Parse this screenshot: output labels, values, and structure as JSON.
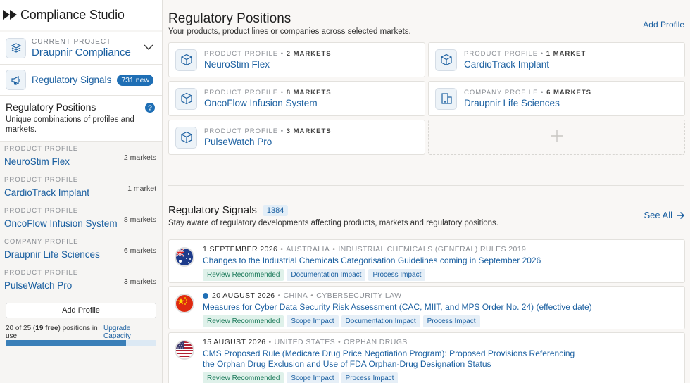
{
  "brand": {
    "name": "Compliance Studio"
  },
  "project": {
    "label": "CURRENT PROJECT",
    "name": "Draupnir Compliance"
  },
  "signals_nav": {
    "label": "Regulatory Signals",
    "badge": "731 new"
  },
  "positions_panel": {
    "title": "Regulatory Positions",
    "description": "Unique combinations of profiles and markets."
  },
  "sidebar_items": [
    {
      "kind": "PRODUCT PROFILE",
      "name": "NeuroStim Flex",
      "count": "2 markets"
    },
    {
      "kind": "PRODUCT PROFILE",
      "name": "CardioTrack Implant",
      "count": "1 market"
    },
    {
      "kind": "PRODUCT PROFILE",
      "name": "OncoFlow Infusion System",
      "count": "8 markets"
    },
    {
      "kind": "COMPANY PROFILE",
      "name": "Draupnir Life Sciences",
      "count": "6 markets"
    },
    {
      "kind": "PRODUCT PROFILE",
      "name": "PulseWatch Pro",
      "count": "3 markets"
    }
  ],
  "add_profile_button": "Add Profile",
  "usage": {
    "prefix": "20 of 25 (",
    "free": "19 free",
    "suffix": ") positions in use",
    "upgrade": "Upgrade Capacity",
    "fraction": 0.8
  },
  "main": {
    "title": "Regulatory Positions",
    "subtitle": "Your products, product lines or companies across selected markets.",
    "add_profile_link": "Add Profile",
    "cards": [
      {
        "kind": "PRODUCT PROFILE",
        "markets": "2 MARKETS",
        "name": "NeuroStim Flex",
        "icon": "cube-icon"
      },
      {
        "kind": "PRODUCT PROFILE",
        "markets": "1 MARKET",
        "name": "CardioTrack Implant",
        "icon": "cube-icon"
      },
      {
        "kind": "PRODUCT PROFILE",
        "markets": "8 MARKETS",
        "name": "OncoFlow Infusion System",
        "icon": "cube-icon"
      },
      {
        "kind": "COMPANY PROFILE",
        "markets": "6 MARKETS",
        "name": "Draupnir Life Sciences",
        "icon": "building-icon"
      },
      {
        "kind": "PRODUCT PROFILE",
        "markets": "3 MARKETS",
        "name": "PulseWatch Pro",
        "icon": "cube-icon"
      }
    ],
    "signals_title": "Regulatory Signals",
    "signals_count": "1384",
    "signals_subtitle": "Stay aware of regulatory developments affecting products, markets and regulatory positions.",
    "see_all": "See All"
  },
  "signals": [
    {
      "date": "1 SEPTEMBER 2026",
      "country": "AUSTRALIA",
      "topic": "INDUSTRIAL CHEMICALS (GENERAL) RULES 2019",
      "headline": "Changes to the Industrial Chemicals Categorisation Guidelines coming in September 2026",
      "flag": "australia-flag",
      "unread": false,
      "tags": [
        "Review Recommended",
        "Documentation Impact",
        "Process Impact"
      ]
    },
    {
      "date": "20 AUGUST 2026",
      "country": "CHINA",
      "topic": "CYBERSECURITY LAW",
      "headline": "Measures for Cyber Data Security Risk Assessment (CAC, MIIT, and MPS Order No. 24) (effective date)",
      "flag": "china-flag",
      "unread": true,
      "tags": [
        "Review Recommended",
        "Scope Impact",
        "Documentation Impact",
        "Process Impact"
      ]
    },
    {
      "date": "15 AUGUST 2026",
      "country": "UNITED STATES",
      "topic": "ORPHAN DRUGS",
      "headline": "CMS Proposed Rule (Medicare Drug Price Negotiation Program): Proposed Provisions Referencing the Orphan Drug Exclusion and Use of FDA Orphan-Drug Designation Status",
      "flag": "usa-flag",
      "unread": false,
      "tags": [
        "Review Recommended",
        "Scope Impact",
        "Process Impact"
      ]
    }
  ]
}
